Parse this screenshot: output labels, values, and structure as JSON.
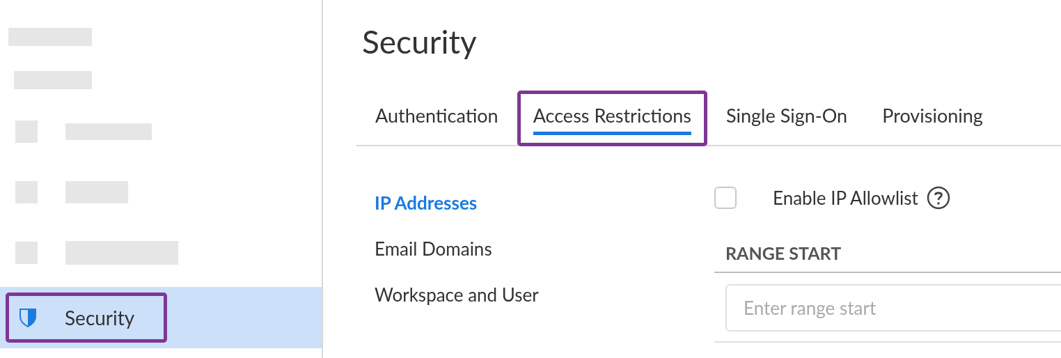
{
  "sidebar": {
    "items": [
      {
        "kind": "placeholder",
        "icon": false
      },
      {
        "kind": "placeholder",
        "icon": false
      },
      {
        "kind": "placeholder",
        "icon": true
      },
      {
        "kind": "placeholder",
        "icon": true
      },
      {
        "kind": "placeholder",
        "icon": true
      },
      {
        "kind": "link",
        "label": "Security",
        "selected": true,
        "highlighted": true
      }
    ]
  },
  "page": {
    "title": "Security"
  },
  "tabs": [
    {
      "label": "Authentication",
      "selected": false,
      "highlighted": false
    },
    {
      "label": "Access Restrictions",
      "selected": true,
      "highlighted": true
    },
    {
      "label": "Single Sign-On",
      "selected": false,
      "highlighted": false
    },
    {
      "label": "Provisioning",
      "selected": false,
      "highlighted": false
    }
  ],
  "subnav": [
    {
      "label": "IP Addresses",
      "selected": true
    },
    {
      "label": "Email Domains",
      "selected": false
    },
    {
      "label": "Workspace and User",
      "selected": false
    }
  ],
  "allowlist": {
    "label": "Enable IP Allowlist",
    "checked": false
  },
  "range": {
    "heading": "RANGE START",
    "placeholder": "Enter range start"
  }
}
